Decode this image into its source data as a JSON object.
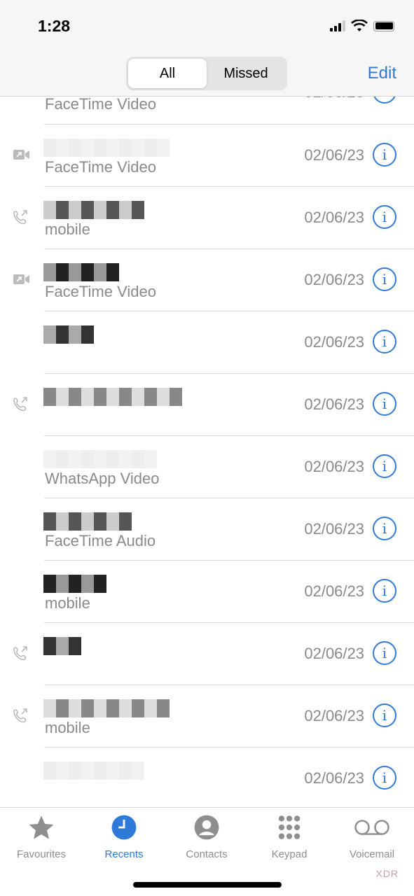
{
  "status_bar": {
    "time": "1:28"
  },
  "segmented": {
    "all": "All",
    "missed": "Missed",
    "selected": "All"
  },
  "edit_label": "Edit",
  "calls": [
    {
      "icon": "none",
      "subtitle": "FaceTime Video",
      "date": "02/06/23"
    },
    {
      "icon": "video-outgoing",
      "subtitle": "FaceTime Video",
      "date": "02/06/23"
    },
    {
      "icon": "phone-outgoing",
      "subtitle": "mobile",
      "date": "02/06/23"
    },
    {
      "icon": "video-outgoing",
      "subtitle": "FaceTime Video",
      "date": "02/06/23"
    },
    {
      "icon": "none",
      "subtitle": "",
      "date": "02/06/23"
    },
    {
      "icon": "phone-outgoing",
      "subtitle": "",
      "date": "02/06/23"
    },
    {
      "icon": "none",
      "subtitle": "WhatsApp Video",
      "date": "02/06/23"
    },
    {
      "icon": "none",
      "subtitle": "FaceTime Audio",
      "date": "02/06/23"
    },
    {
      "icon": "none",
      "subtitle": "mobile",
      "date": "02/06/23"
    },
    {
      "icon": "phone-outgoing",
      "subtitle": "",
      "date": "02/06/23"
    },
    {
      "icon": "phone-outgoing",
      "subtitle": "mobile",
      "date": "02/06/23"
    },
    {
      "icon": "none",
      "subtitle": "",
      "date": "02/06/23"
    }
  ],
  "tabs": [
    {
      "label": "Favourites",
      "icon": "star-icon"
    },
    {
      "label": "Recents",
      "icon": "clock-icon",
      "active": true
    },
    {
      "label": "Contacts",
      "icon": "person-icon"
    },
    {
      "label": "Keypad",
      "icon": "keypad-icon"
    },
    {
      "label": "Voicemail",
      "icon": "voicemail-icon"
    }
  ],
  "watermark": "XDR",
  "colors": {
    "accent": "#2f7ad9",
    "secondary_text": "#8a8a8e"
  }
}
